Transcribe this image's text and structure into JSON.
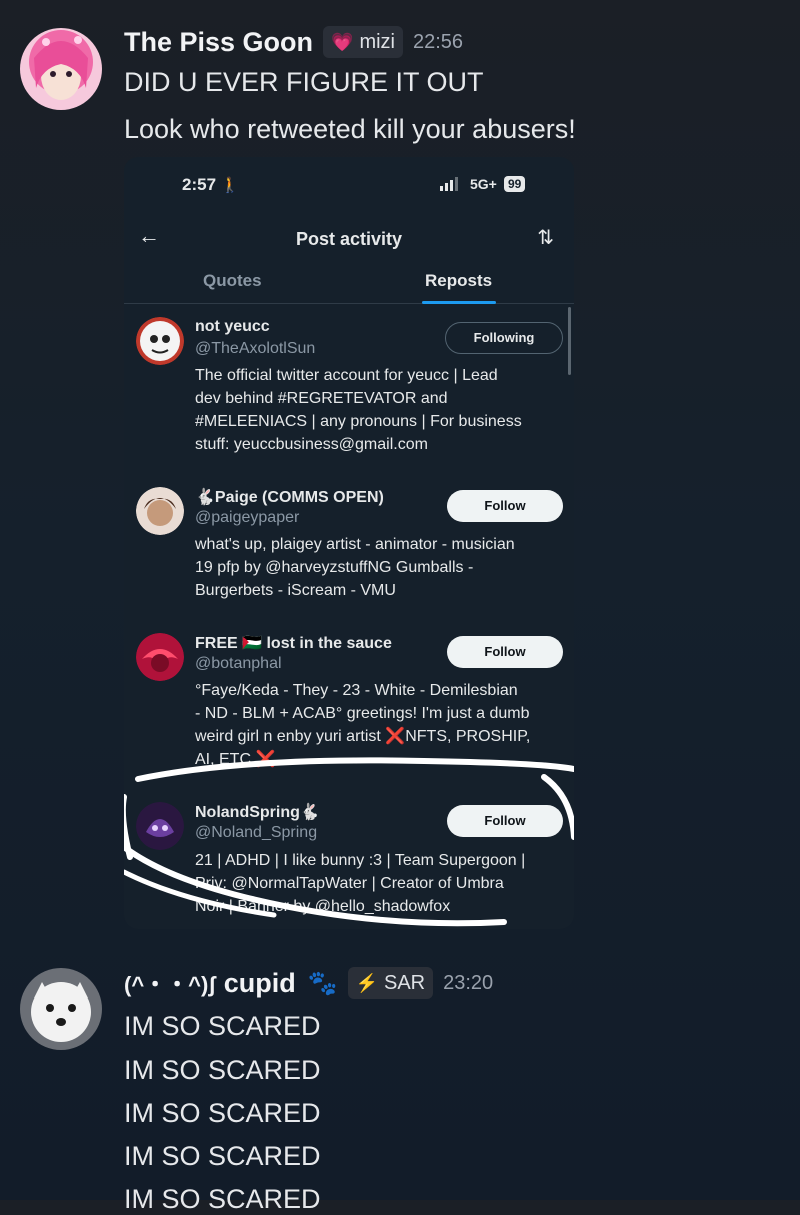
{
  "messages": [
    {
      "username": "The Piss Goon",
      "tag": {
        "icon": "pink-heart-icon",
        "label": "mizi"
      },
      "time": "22:56",
      "lines": [
        "DID U EVER FIGURE IT OUT",
        "Look who retweeted kill your abusers!"
      ]
    },
    {
      "username": "cupid",
      "kaomoji": "(^・・^)ʃ",
      "paw": "🐾",
      "tag": {
        "icon": "lightning-icon",
        "label": "SAR"
      },
      "time": "23:20",
      "lines": [
        "IM SO SCARED",
        "IM SO SCARED",
        "IM SO SCARED",
        "IM SO SCARED",
        "IM SO SCARED"
      ]
    }
  ],
  "embed": {
    "status": {
      "time": "2:57",
      "network": "5G+",
      "battery": "99"
    },
    "title": "Post activity",
    "tabs": [
      "Quotes",
      "Reposts"
    ],
    "active_tab": "Reposts",
    "entries": [
      {
        "name": "not yeucc",
        "handle": "@TheAxolotlSun",
        "button": "Following",
        "bio": [
          "The official twitter account for yeucc | Lead",
          "dev behind #REGRETEVATOR and",
          "#MELEENIACS | any pronouns | For business",
          "stuff: yeuccbusiness@gmail.com"
        ]
      },
      {
        "name": "🐇Paige (COMMS OPEN)",
        "handle": "@paigeypaper",
        "button": "Follow",
        "bio": [
          "what's up, plaigey artist - animator - musician",
          "19 pfp by @harveyzstuffNG Gumballs -",
          "Burgerbets - iScream - VMU"
        ]
      },
      {
        "name": "FREE 🇵🇸 lost in the sauce",
        "handle": "@botanphal",
        "button": "Follow",
        "bio": [
          "°Faye/Keda - They - 23 - White - Demilesbian",
          "- ND - BLM + ACAB° greetings! I'm just a dumb",
          "weird girl n enby yuri artist ❌NFTS, PROSHIP,",
          "AI, ETC.❌"
        ]
      },
      {
        "name": "NolandSpring🐇",
        "handle": "@Noland_Spring",
        "button": "Follow",
        "bio": [
          "21 | ADHD | I like bunny :3 | Team Supergoon |",
          "Priv: @NormalTapWater | Creator of Umbra",
          "Noir | Banner by @hello_shadowfox"
        ]
      }
    ]
  },
  "colors": {
    "accent_blue": "#1d9bf0",
    "background": "#15202b",
    "scribble": "#ffffff"
  }
}
